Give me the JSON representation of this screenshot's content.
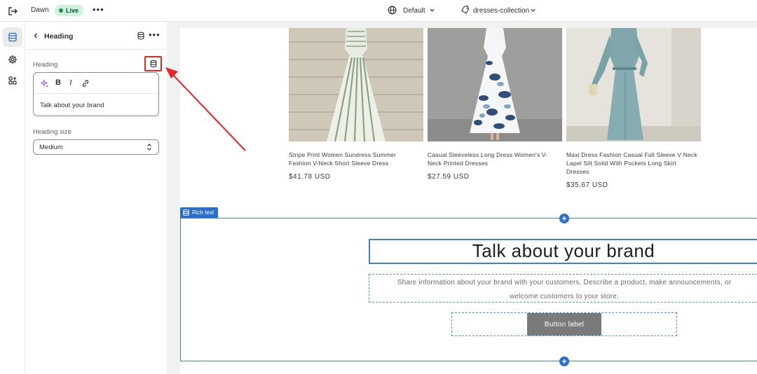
{
  "topbar": {
    "theme_name": "Dawn",
    "live_label": "Live",
    "more_label": "•••",
    "market_label": "Default",
    "template_label": "dresses-collection"
  },
  "panel": {
    "title": "Heading",
    "more_label": "•••",
    "heading_label": "Heading",
    "bold_label": "B",
    "italic_label": "I",
    "heading_value": "Talk about your brand",
    "size_label": "Heading size",
    "size_value": "Medium"
  },
  "products": [
    {
      "title_line1": "Stripe Print Women Sundress Summer",
      "title_line2": "Fashion V-Neck Short Sleeve Dress",
      "title_line3": "",
      "price": "$41.78 USD"
    },
    {
      "title_line1": "Casual Sleeveless Long Dress Women's V-",
      "title_line2": "Neck Printed Dresses",
      "title_line3": "",
      "price": "$27.59 USD"
    },
    {
      "title_line1": "Maxi Dress Fashion Casual Full Sleeve V Neck",
      "title_line2": "Lapel Slit Solid With Pockets Long Skirt",
      "title_line3": "Dresses",
      "price": "$35.67 USD"
    }
  ],
  "section": {
    "tag_label": "Rich text",
    "heading": "Talk about your brand",
    "body_line1": "Share information about your brand with your customers. Describe a product, make announcements, or",
    "body_line2": "welcome customers to your store.",
    "button_label": "Button label"
  },
  "colors": {
    "accent_blue": "#2c6ecb",
    "highlight_red": "#e5252a",
    "live_green": "#29845a"
  }
}
